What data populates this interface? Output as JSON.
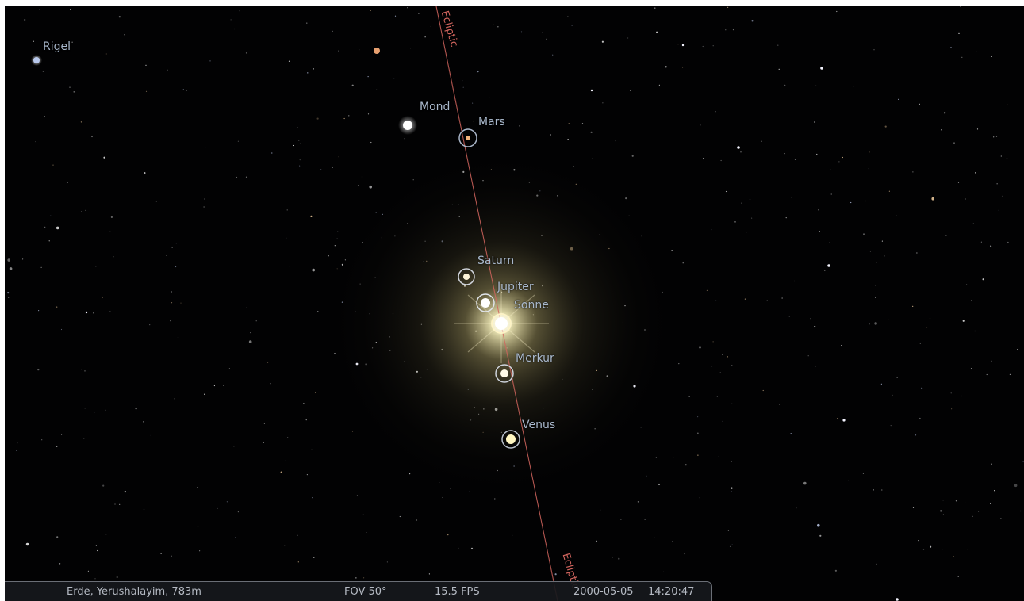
{
  "window": {
    "app": "Stellarium planetarium"
  },
  "sky": {
    "background_color": "#020203",
    "ecliptic_color": "#d2655e",
    "ecliptic_label": "Ecliptic",
    "star_labels": {
      "rigel": "Rigel"
    },
    "planet_labels": {
      "mond": "Mond",
      "mars": "Mars",
      "saturn": "Saturn",
      "jupiter": "Jupiter",
      "sonne": "Sonne",
      "merkur": "Merkur",
      "venus": "Venus"
    }
  },
  "status_bar": {
    "location": "Erde, Yerushalayim, 783m",
    "fov": "FOV 50°",
    "fps": "15.5 FPS",
    "date": "2000-05-05",
    "time": "14:20:47"
  }
}
